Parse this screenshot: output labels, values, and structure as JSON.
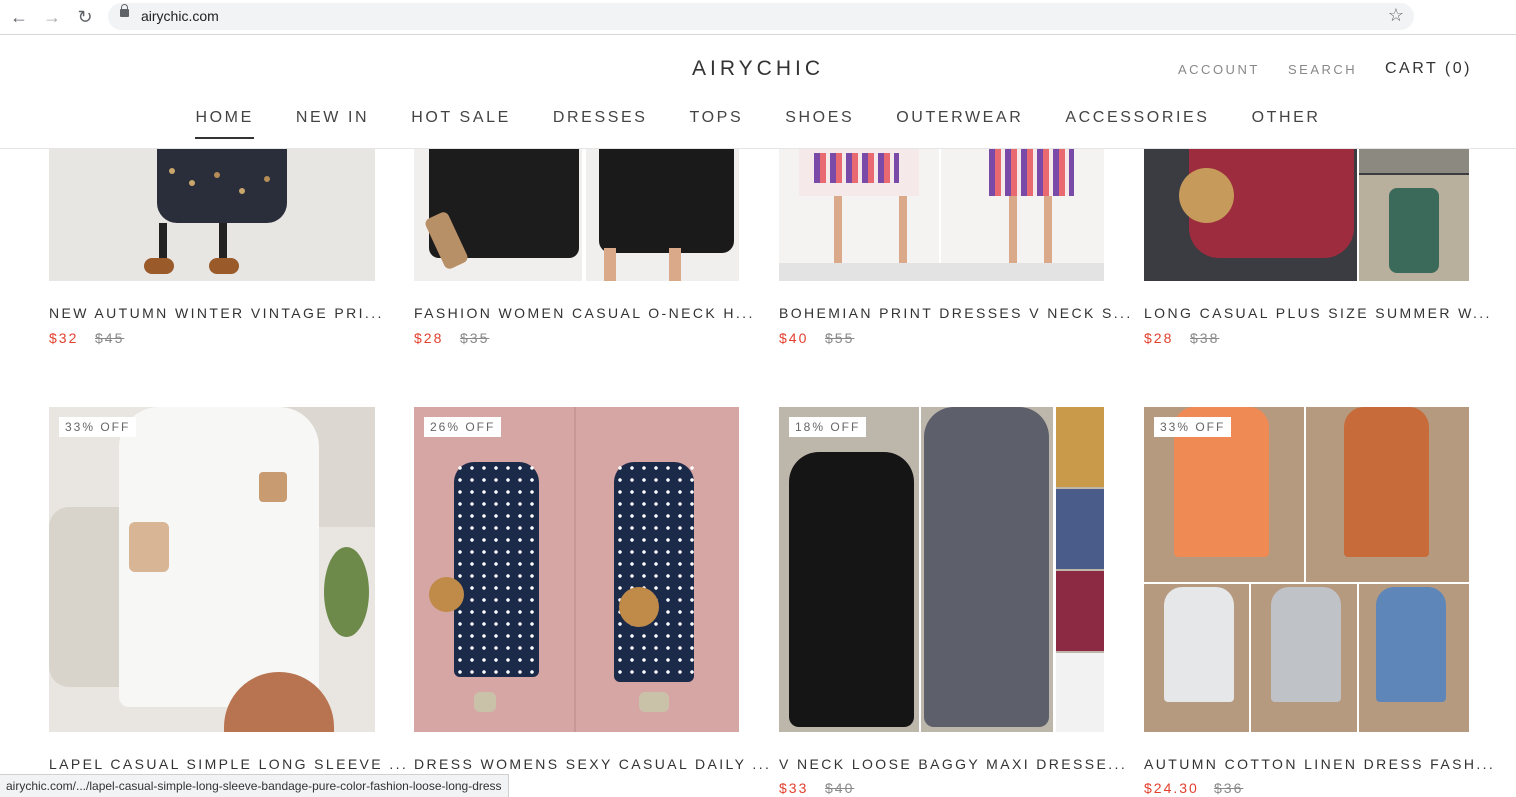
{
  "browser": {
    "url": "airychic.com",
    "status_url": "airychic.com/.../lapel-casual-simple-long-sleeve-bandage-pure-color-fashion-loose-long-dress"
  },
  "header": {
    "logo": "AIRYCHIC",
    "account": "ACCOUNT",
    "search": "SEARCH",
    "cart": "CART (0)"
  },
  "menu": [
    "HOME",
    "NEW IN",
    "HOT SALE",
    "DRESSES",
    "TOPS",
    "SHOES",
    "OUTERWEAR",
    "ACCESSORIES",
    "OTHER"
  ],
  "products_top": [
    {
      "name": "NEW AUTUMN WINTER VINTAGE PRI...",
      "price": "$32",
      "old_price": "$45"
    },
    {
      "name": "FASHION WOMEN CASUAL O-NECK H...",
      "price": "$28",
      "old_price": "$35"
    },
    {
      "name": "BOHEMIAN PRINT DRESSES V NECK S...",
      "price": "$40",
      "old_price": "$55"
    },
    {
      "name": "LONG CASUAL PLUS SIZE SUMMER W...",
      "price": "$28",
      "old_price": "$38"
    }
  ],
  "products_bottom": [
    {
      "badge": "33% OFF",
      "name": "LAPEL CASUAL SIMPLE LONG SLEEVE ...",
      "price": "",
      "old_price": ""
    },
    {
      "badge": "26% OFF",
      "name": "DRESS WOMENS SEXY CASUAL DAILY ...",
      "price": "",
      "old_price": ""
    },
    {
      "badge": "18% OFF",
      "name": "V NECK LOOSE BAGGY MAXI DRESSE...",
      "price": "$33",
      "old_price": "$40"
    },
    {
      "badge": "33% OFF",
      "name": "AUTUMN COTTON LINEN DRESS FASH...",
      "price": "$24.30",
      "old_price": "$36"
    }
  ],
  "colors": {
    "sale_red": "#e23f2e",
    "text": "#333333",
    "muted": "#888888"
  }
}
